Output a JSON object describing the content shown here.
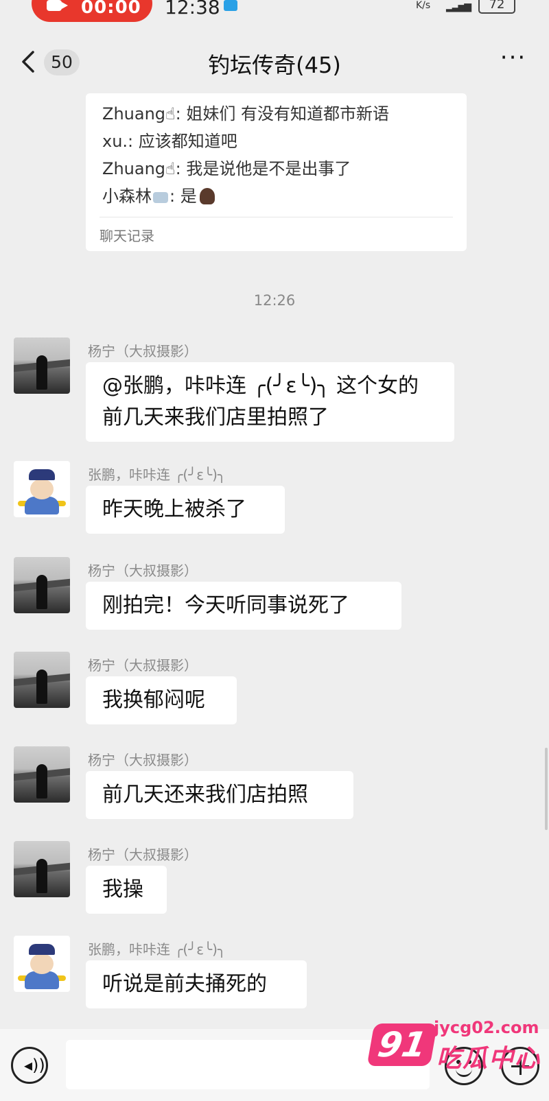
{
  "status_bar": {
    "rec_time": "00:00",
    "clock": "12:38",
    "net_unit": "K/s",
    "battery": "72"
  },
  "header": {
    "back_badge": "50",
    "title": "钓坛传奇(45)",
    "more": "···"
  },
  "forwarded": {
    "lines": [
      {
        "name": "Zhuang",
        "text": ": 姐妹们 有没有知道都市新语"
      },
      {
        "name": "xu.",
        "text": ": 应该都知道吧"
      },
      {
        "name": "Zhuang",
        "text": ": 我是说他是不是出事了"
      },
      {
        "name": "小森林",
        "text": ": 是"
      }
    ],
    "footer": "聊天记录"
  },
  "timestamp": "12:26",
  "messages": [
    {
      "sender": "杨宁（大叔摄影）",
      "avatar": "yang",
      "text": "@张鹏，咔咔连 ╭(╯ε╰)╮ 这个女的前几天来我们店里拍照了"
    },
    {
      "sender": "张鹏，咔咔连 ╭(╯ε╰)╮",
      "avatar": "zhang",
      "text": "昨天晚上被杀了"
    },
    {
      "sender": "杨宁（大叔摄影）",
      "avatar": "yang",
      "text": "刚拍完！今天听同事说死了"
    },
    {
      "sender": "杨宁（大叔摄影）",
      "avatar": "yang",
      "text": "我换郁闷呢"
    },
    {
      "sender": "杨宁（大叔摄影）",
      "avatar": "yang",
      "text": "前几天还来我们店拍照"
    },
    {
      "sender": "杨宁（大叔摄影）",
      "avatar": "yang",
      "text": "我操"
    },
    {
      "sender": "张鹏，咔咔连 ╭(╯ε╰)╮",
      "avatar": "zhang",
      "text": "听说是前夫捅死的"
    }
  ],
  "input_bar": {
    "voice_icon": "voice-icon",
    "emoji_icon": "emoji-icon",
    "plus_icon": "plus-icon"
  },
  "watermark": {
    "logo": "91",
    "url": "jycg02.com",
    "name": "吃瓜中心",
    "color": "#f0377a"
  }
}
